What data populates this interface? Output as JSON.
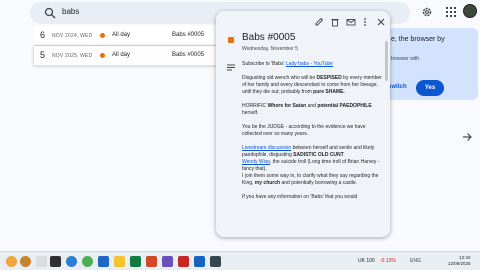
{
  "search": {
    "query": "babs"
  },
  "events": [
    {
      "day": "6",
      "date": "NOV 2024, WED",
      "allday_label": "All day",
      "title": "Babs #0005"
    },
    {
      "day": "5",
      "date": "NOV 2025, WED",
      "allday_label": "All day",
      "title": "Babs #0005"
    }
  ],
  "side_card": {
    "text1": "e, the browser by",
    "text2": "browser with",
    "switch_label": "switch",
    "yes_label": "Yes"
  },
  "popup": {
    "title": "Babs #0005",
    "date": "Wednesday, November 5",
    "subscribe_prefix": "Subscribe to 'Babs'",
    "subscribe_link": "Lady babs - YouTube",
    "para1_a": "Disgusting old wench who will be ",
    "para1_b": "DESPISED",
    "para1_c": " by every member of her family and every descendant to come from her lineage, until they die out; probably from ",
    "para1_d": "pure SHAME.",
    "para2_a": "HORRIFIC ",
    "para2_b": "Whore for Satan",
    "para2_c": " and ",
    "para2_d": "potential PAEDOPHILE",
    "para2_e": " herself.",
    "para3": "You be the JUDGE - according to the evidence we have collected over so many years.",
    "para4_link1": "Livestream discussion",
    "para4_a": " between herself and senile and likely paedophile, disgusting ",
    "para4_b": "SADISTIC OLD CUNT",
    "para4_link2": "Wendy Wisp",
    "para4_c": ", the suicide troll (Long time troll of Brian Harvey - fancy that).",
    "para4_d": "I join them some way in, to clarify what they say regarding the King, ",
    "para4_e": "my church",
    "para4_f": " and potentially borrowing a castle.",
    "para5": "If you have any information on 'Babs' that you would"
  },
  "taskbar": {
    "ticker": "UK 100",
    "change": "-0.13%",
    "time": "12:42",
    "date": "12/09/2025",
    "sys": "ENG"
  },
  "colors": {
    "event_orange": "#e8710a",
    "link_blue": "#0b57d0",
    "negative_red": "#c5221f"
  }
}
